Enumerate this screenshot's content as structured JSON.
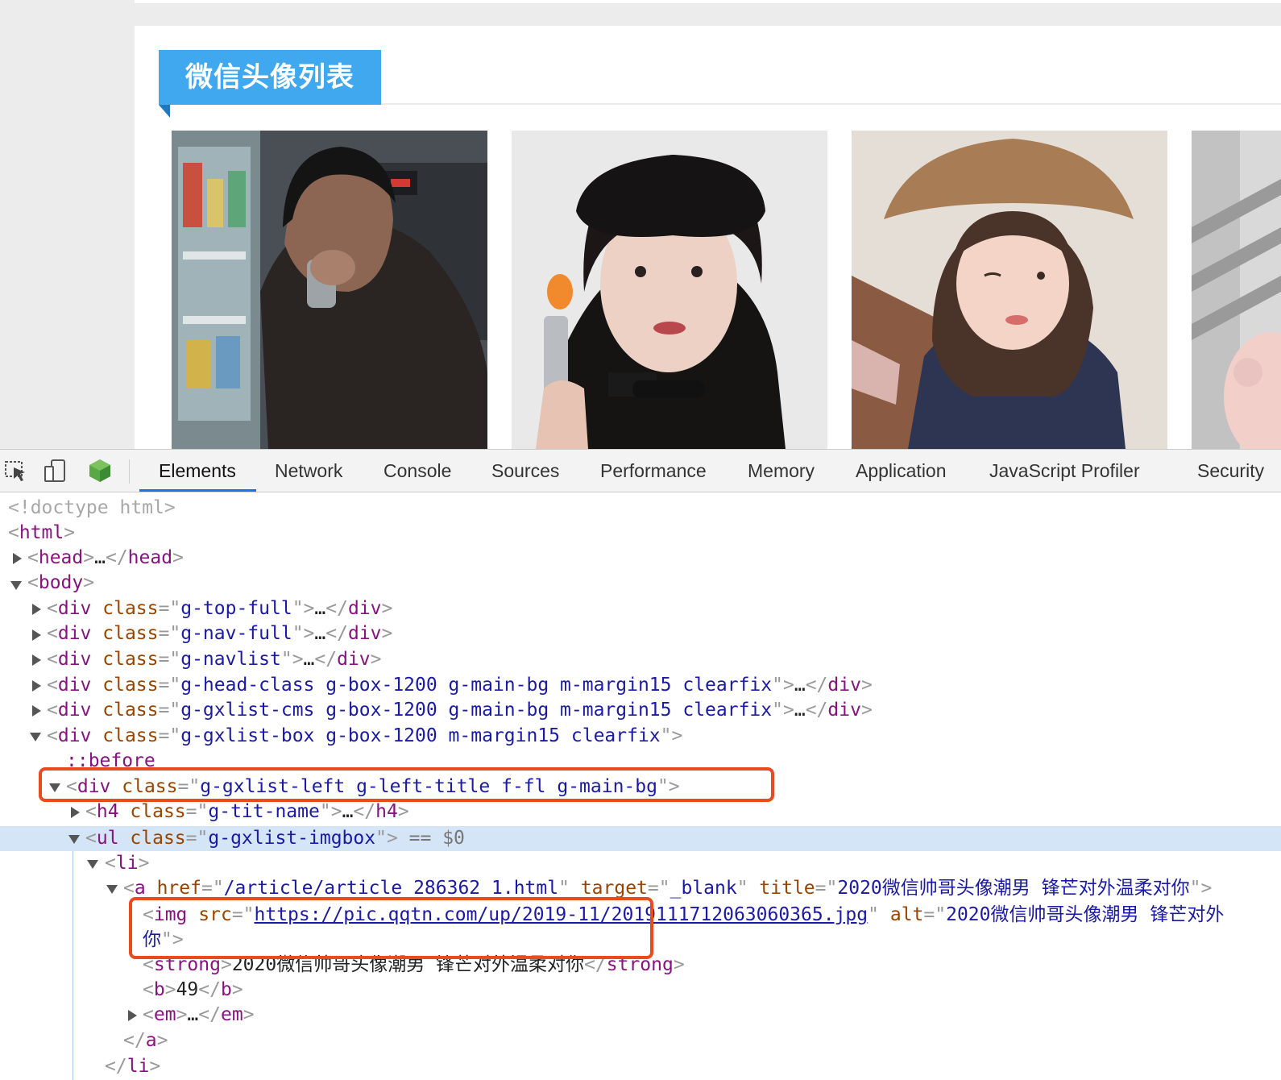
{
  "page": {
    "section_title": "微信头像列表",
    "avatar_count": 4
  },
  "devtools": {
    "tabs": [
      "Elements",
      "Network",
      "Console",
      "Sources",
      "Performance",
      "Memory",
      "Application",
      "JavaScript Profiler",
      "Security"
    ],
    "active_tab": "Elements",
    "toolbar_icons": [
      "inspect-element-icon",
      "device-toggle-icon",
      "extension-cube-icon"
    ],
    "accent_color": "#1a73e8"
  },
  "dom": {
    "doctype": "<!doctype html>",
    "html_tag": "html",
    "head_tag": "head",
    "body_tag": "body",
    "div_tag": "div",
    "h4_tag": "h4",
    "ul_tag": "ul",
    "li_tag": "li",
    "a_tag": "a",
    "img_tag": "img",
    "strong_tag": "strong",
    "b_tag": "b",
    "em_tag": "em",
    "class_attr": "class",
    "href_attr": "href",
    "target_attr": "target",
    "title_attr": "title",
    "src_attr": "src",
    "alt_attr": "alt",
    "ellipsis": "…",
    "class_top_full": "g-top-full",
    "class_nav_full": "g-nav-full",
    "class_navlist": "g-navlist",
    "class_head_class": "g-head-class g-box-1200 g-main-bg m-margin15 clearfix",
    "class_gxlist_cms": "g-gxlist-cms g-box-1200 g-main-bg m-margin15 clearfix",
    "class_gxlist_box": "g-gxlist-box g-box-1200 m-margin15 clearfix",
    "pseudo_before": "::before",
    "class_gxlist_left": "g-gxlist-left g-left-title f-fl g-main-bg",
    "class_tit_name": "g-tit-name",
    "class_imgbox": "g-gxlist-imgbox",
    "selected_marker": "== $0",
    "href_value": "/article/article_286362_1.html",
    "target_value": "_blank",
    "title_value": "2020微信帅哥头像潮男 锋芒对外温柔对你",
    "img_src": "https://pic.qqtn.com/up/2019-11/2019111712063060365.jpg",
    "img_alt_start": "2020微信帅哥头像潮男 锋芒对外",
    "img_alt_end": "你",
    "strong_text": "2020微信帅哥头像潮男 锋芒对外温柔对你",
    "b_text": "49"
  }
}
